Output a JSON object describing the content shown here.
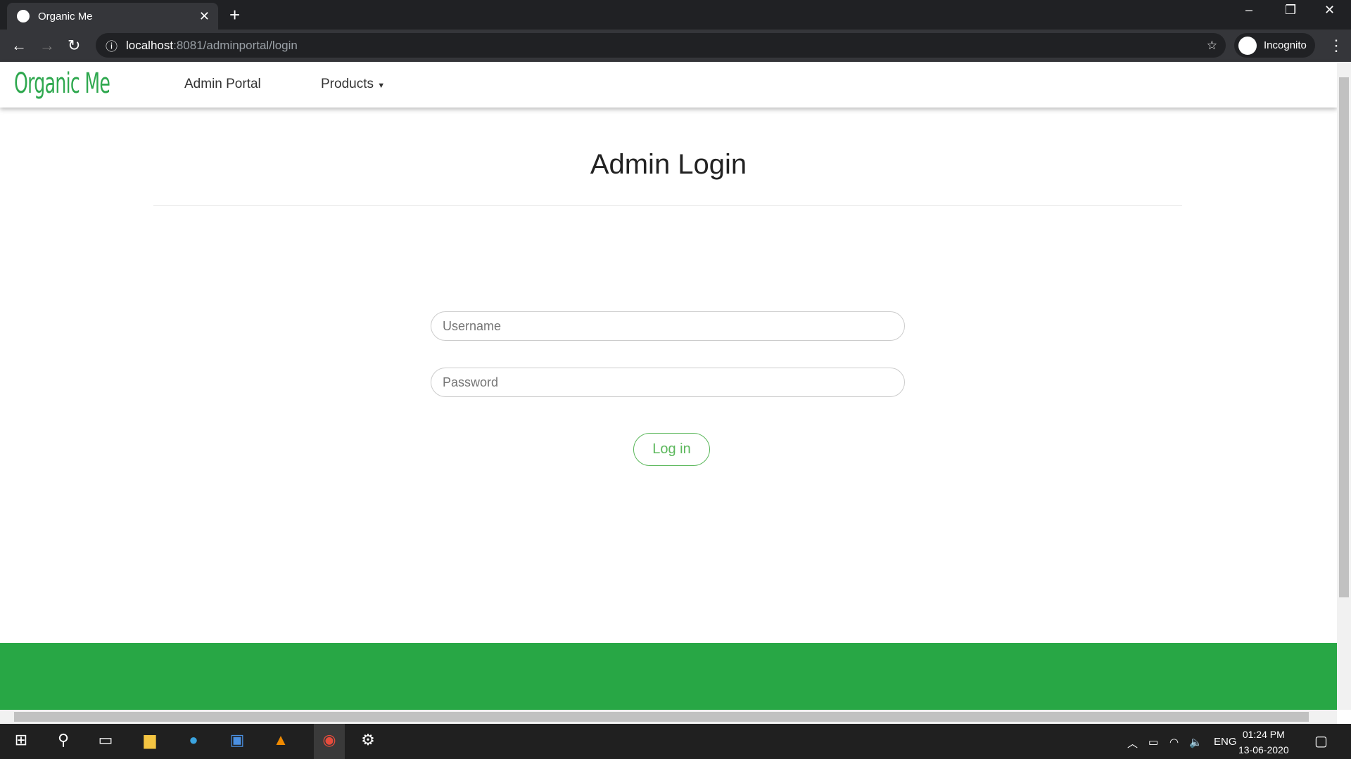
{
  "browser": {
    "tab_title": "Organic Me",
    "url_host": "localhost",
    "url_rest": ":8081/adminportal/login",
    "profile": "Incognito"
  },
  "navbar": {
    "brand": "Organic Me",
    "links": [
      "Admin Portal",
      "Products"
    ]
  },
  "main": {
    "title": "Admin Login",
    "username_placeholder": "Username",
    "password_placeholder": "Password",
    "login_label": "Log in"
  },
  "colors": {
    "brand": "#2fa84f",
    "footer": "#28a745",
    "button": "#5cb85c"
  },
  "taskbar": {
    "lang": "ENG",
    "time": "01:24 PM",
    "date": "13-06-2020"
  }
}
